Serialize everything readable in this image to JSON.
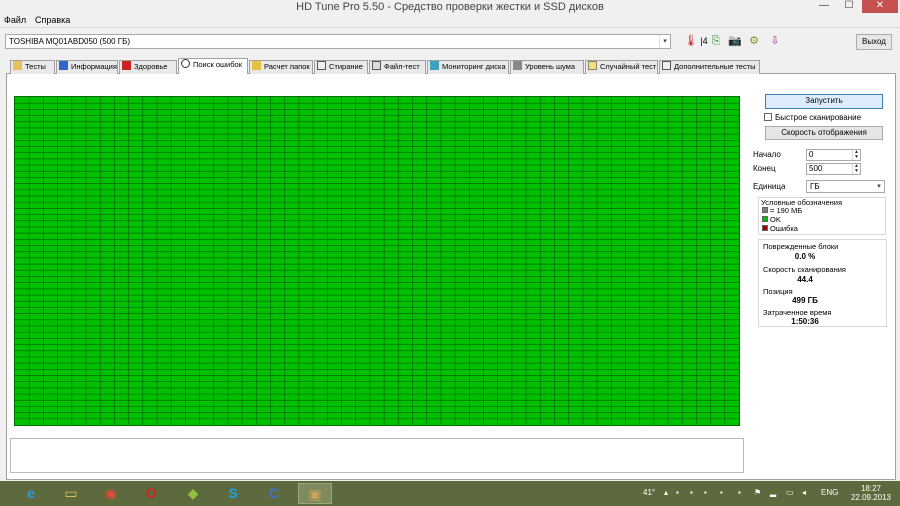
{
  "window": {
    "title": "HD Tune Pro 5.50 - Средство проверки жестки и SSD дисков",
    "minimize": "—",
    "maximize": "☐",
    "close": "✕"
  },
  "menu": [
    "Файл",
    "Справка"
  ],
  "toolbar": {
    "drive": "TOSHIBA MQ01ABD050 (500 ГБ)",
    "temperature": "",
    "exit_label": "Выход"
  },
  "tabs": [
    {
      "label": "Тесты",
      "icon": "benchmark-icon"
    },
    {
      "label": "Информация",
      "icon": "info-icon"
    },
    {
      "label": "Здоровье",
      "icon": "health-icon"
    },
    {
      "label": "Поиск ошибок",
      "icon": "error-scan-icon"
    },
    {
      "label": "Расчет папок",
      "icon": "folder-icon"
    },
    {
      "label": "Стирание",
      "icon": "erase-icon"
    },
    {
      "label": "Файл-тест",
      "icon": "file-icon"
    },
    {
      "label": "Мониторинг диска",
      "icon": "monitor-icon"
    },
    {
      "label": "Уровень шума",
      "icon": "speaker-icon"
    },
    {
      "label": "Случайный тест",
      "icon": "random-icon"
    },
    {
      "label": "Дополнительные тесты",
      "icon": "extra-tests-icon"
    }
  ],
  "active_tab": "Поиск ошибок",
  "scan": {
    "start_label": "Запустить",
    "quick_scan_label": "Быстрое сканирование",
    "quick_scan_checked": false,
    "display_speed_label": "Скорость отображения",
    "start_field_label": "Начало",
    "start_value": "0",
    "end_field_label": "Конец",
    "end_value": "500",
    "unit_label": "Единица",
    "unit_value": "ГБ",
    "block_status": "all-ok",
    "colors": {
      "ok": "#00c000",
      "error": "#a00000",
      "grid_line": "#006b00"
    }
  },
  "legend": {
    "title": "Условные обозначения",
    "items": [
      {
        "label": "= 190 МБ",
        "color": "#808080"
      },
      {
        "label": "OK",
        "color": "#00c000"
      },
      {
        "label": "Ошибка",
        "color": "#a00000"
      }
    ]
  },
  "stats": {
    "damaged_label": "Поврежденные блоки",
    "damaged_value": "0.0 %",
    "speed_label": "Скорость сканирования",
    "speed_value": "44.4",
    "position_label": "Позиция",
    "position_value": "499 ГБ",
    "elapsed_label": "Затраченное время",
    "elapsed_value": "1:50:36"
  },
  "taskbar": {
    "apps": [
      {
        "name": "internet-explorer-icon",
        "glyph": "e",
        "color": "#2b9be5"
      },
      {
        "name": "file-explorer-icon",
        "glyph": "▭",
        "color": "#e8c35a"
      },
      {
        "name": "chrome-icon",
        "glyph": "◉",
        "color": "#e34b3a"
      },
      {
        "name": "opera-icon",
        "glyph": "O",
        "color": "#d82020"
      },
      {
        "name": "game-app-icon",
        "glyph": "◆",
        "color": "#8fbf40"
      },
      {
        "name": "skype-icon",
        "glyph": "S",
        "color": "#1fa0e8"
      },
      {
        "name": "ccleaner-icon",
        "glyph": "C",
        "color": "#3b74c8"
      },
      {
        "name": "hdtune-icon",
        "glyph": "▣",
        "color": "#c9a35a"
      }
    ],
    "temp": "41°",
    "lang": "ENG",
    "time": "18:27",
    "date": "22.09.2013"
  }
}
